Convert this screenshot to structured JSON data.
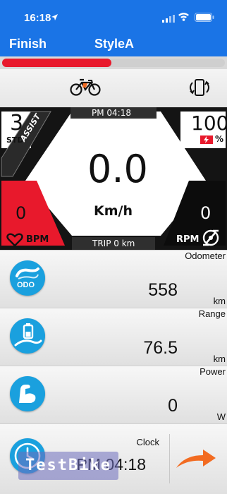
{
  "status": {
    "time": "16:18"
  },
  "nav": {
    "finish_label": "Finish",
    "title": "StyleA"
  },
  "progress": {
    "fraction": 0.49,
    "color": "#e8192c"
  },
  "dashboard": {
    "clock": "PM 04:18",
    "gear_number": "3",
    "gear_mode": "STD",
    "assist_label": "ASSIST",
    "battery_percent": "100",
    "battery_unit": "%",
    "speed": "0.0",
    "speed_unit": "Km/h",
    "heart_rate": "0",
    "heart_unit": "BPM",
    "cadence": "0",
    "cadence_unit": "RPM",
    "trip": "TRIP 0 km"
  },
  "rows": [
    {
      "label": "Odometer",
      "value": "558",
      "unit": "km",
      "icon": "odo-icon",
      "icon_text": "ODO"
    },
    {
      "label": "Range",
      "value": "76.5",
      "unit": "km",
      "icon": "battery-road-icon"
    },
    {
      "label": "Power",
      "value": "0",
      "unit": "W",
      "icon": "muscle-arm-icon"
    },
    {
      "label": "Clock",
      "value": "PM 04:18",
      "unit": "",
      "icon": "clock-icon"
    }
  ],
  "watermark": "TestBike",
  "colors": {
    "accent": "#1a74e6",
    "icon_blue": "#1aa0de",
    "red": "#e8192c",
    "arrow": "#f26b21"
  }
}
